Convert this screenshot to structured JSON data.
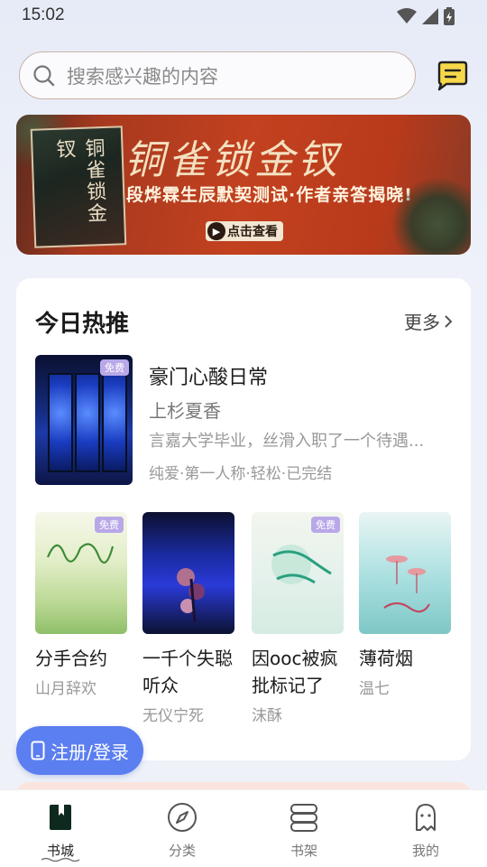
{
  "status": {
    "time": "15:02"
  },
  "search": {
    "placeholder": "搜索感兴趣的内容"
  },
  "icons": {
    "search": "search-icon",
    "message": "chat-bubble-icon",
    "more": "chevron-right-icon",
    "wifi": "wifi-icon",
    "signal": "signal-icon",
    "battery": "battery-charging-icon"
  },
  "banner": {
    "book_title": "铜雀锁金钗",
    "title": "铜雀锁金钗",
    "subtitle": "段烨霖生辰默契测试·作者亲答揭晓!",
    "button": "点击查看"
  },
  "hot": {
    "title": "今日热推",
    "more": "更多",
    "featured": {
      "title": "豪门心酸日常",
      "author": "上杉夏香",
      "desc": "言嘉大学毕业，丝滑入职了一个待遇...",
      "tags": "纯爱·第一人称·轻松·已完结",
      "badge": "免费"
    },
    "books": [
      {
        "title": "分手合约",
        "author": "山月辞欢",
        "badge": "免费"
      },
      {
        "title": "一千个失聪听众",
        "author": "无仪宁死",
        "badge": ""
      },
      {
        "title": "因ooc被疯批标记了",
        "author": "沫酥",
        "badge": "免费"
      },
      {
        "title": "薄荷烟",
        "author": "温七",
        "badge": ""
      }
    ]
  },
  "login_button": "注册/登录",
  "tabs": [
    {
      "label": "书城",
      "active": true
    },
    {
      "label": "分类",
      "active": false
    },
    {
      "label": "书架",
      "active": false
    },
    {
      "label": "我的",
      "active": false
    }
  ],
  "colors": {
    "accent": "#5b7ef0",
    "banner": "#c2411f",
    "free_badge": "#b9a8e8"
  }
}
